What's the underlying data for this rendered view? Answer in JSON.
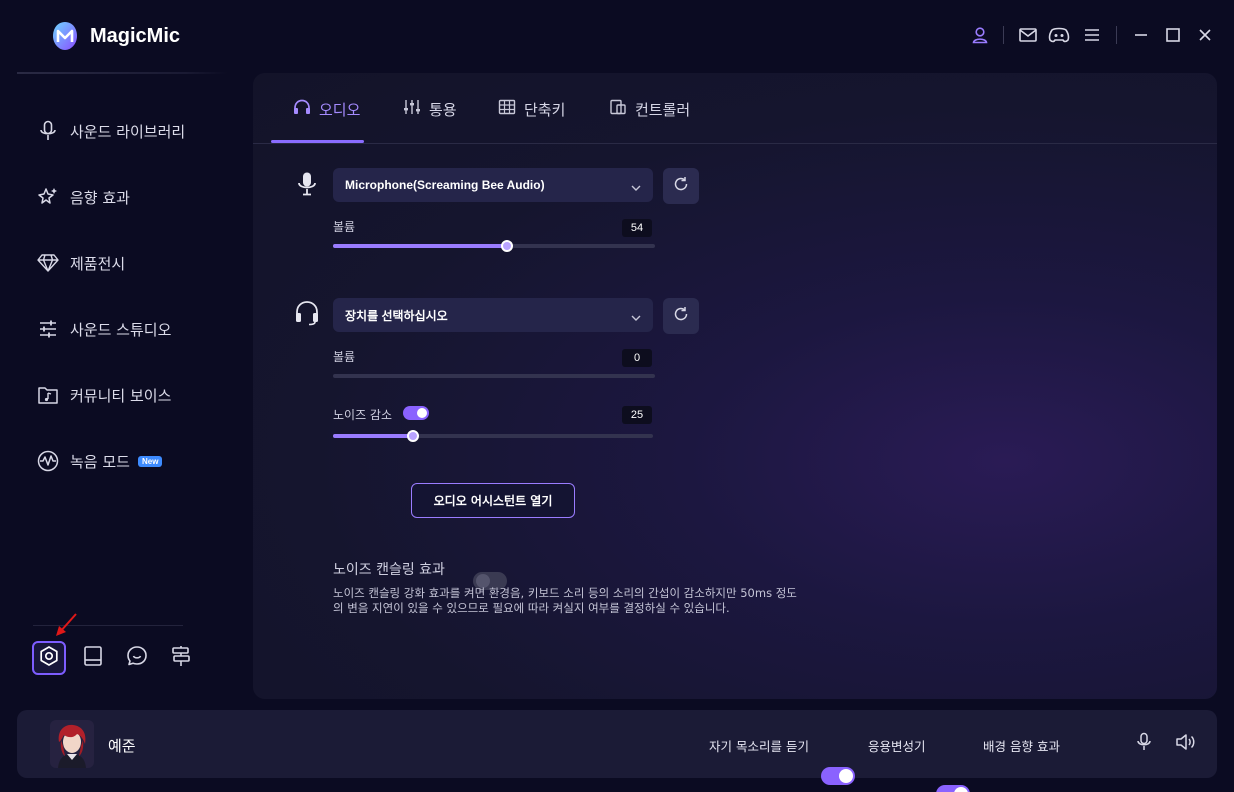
{
  "app": {
    "title": "MagicMic"
  },
  "sidebar": {
    "items": [
      {
        "label": "사운드 라이브러리",
        "icon": "microphone-icon"
      },
      {
        "label": "음향 효과",
        "icon": "sparkle-star-icon"
      },
      {
        "label": "제품전시",
        "icon": "diamond-icon"
      },
      {
        "label": "사운드 스튜디오",
        "icon": "sliders-icon"
      },
      {
        "label": "커뮤니티 보이스",
        "icon": "music-folder-icon"
      },
      {
        "label": "녹음 모드",
        "icon": "waveform-icon",
        "badge": "New"
      }
    ],
    "bottom_icons": [
      "settings-icon",
      "book-icon",
      "chat-icon",
      "signpost-icon"
    ]
  },
  "tabs": [
    {
      "label": "오디오",
      "active": true
    },
    {
      "label": "통용",
      "active": false
    },
    {
      "label": "단축키",
      "active": false
    },
    {
      "label": "컨트롤러",
      "active": false
    }
  ],
  "audio": {
    "microphone": {
      "device": "Microphone(Screaming Bee Audio)",
      "volume_label": "볼륨",
      "volume": 54
    },
    "headset": {
      "device": "장치를 선택하십시오",
      "volume_label": "볼륨",
      "volume": 0,
      "noise_label": "노이즈 감소",
      "noise_enabled": true,
      "noise_value": 25
    },
    "assistant_button": "오디오 어시스턴트 열기",
    "noise_cancel": {
      "title": "노이즈 캔슬링 효과",
      "enabled": false,
      "description": "노이즈 캔슬링 강화 효과를 켜면 환경음, 키보드 소리 등의 소리의 간섭이 감소하지만 50ms 정도의 변음 지연이 있을 수 있으므로 필요에 따라 켜실지 여부를 결정하실 수 있습니다."
    }
  },
  "bottom_bar": {
    "username": "예준",
    "hear_myself": "자기 목소리를 듣기",
    "voice_changer": "응용변성기",
    "bg_effect": "배경 음향 효과"
  },
  "colors": {
    "accent": "#8a62ff",
    "background": "#0b0b22",
    "panel": "#15152e"
  }
}
